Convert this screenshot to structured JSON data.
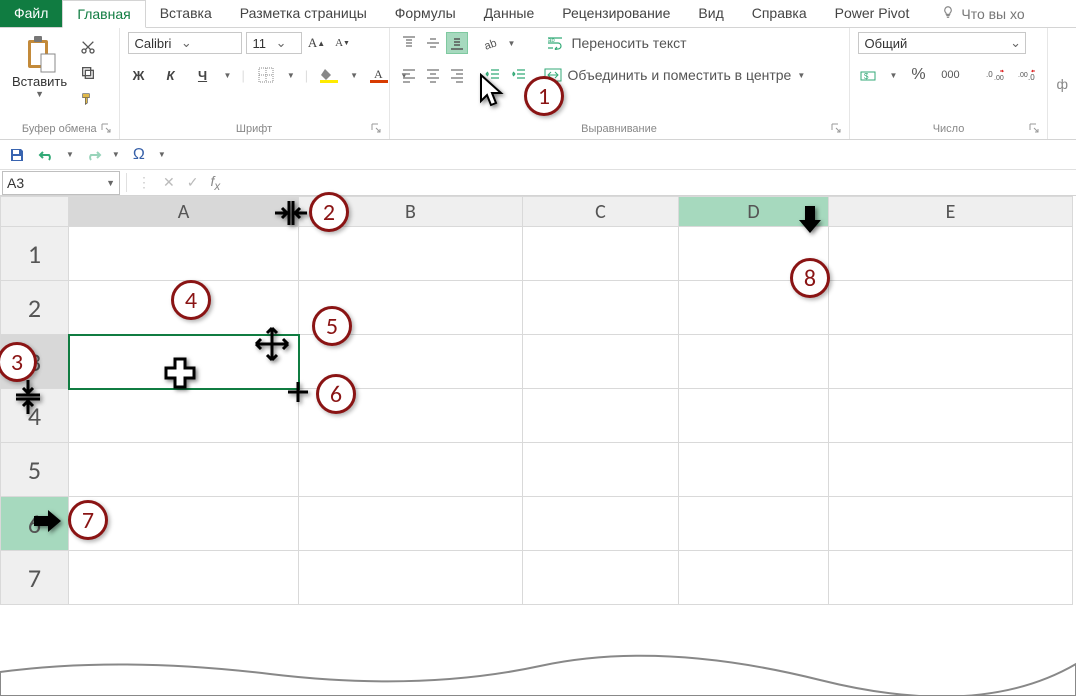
{
  "tabs": {
    "file": "Файл",
    "home": "Главная",
    "insert": "Вставка",
    "layout": "Разметка страницы",
    "formulas": "Формулы",
    "data": "Данные",
    "review": "Рецензирование",
    "view": "Вид",
    "help": "Справка",
    "powerpivot": "Power Pivot",
    "tellme": "Что вы хо"
  },
  "ribbon": {
    "paste": "Вставить",
    "clipboard_label": "Буфер обмена",
    "font_label": "Шрифт",
    "alignment_label": "Выравнивание",
    "number_label": "Число",
    "font_name": "Calibri",
    "font_size": "11",
    "bold": "Ж",
    "italic": "К",
    "underline": "Ч",
    "wrap_text": "Переносить текст",
    "merge_center": "Объединить и поместить в центре",
    "number_format": "Общий",
    "percent_sign": "%",
    "thousands": "000"
  },
  "namebox": "A3",
  "grid": {
    "columns": [
      "A",
      "B",
      "C",
      "D",
      "E"
    ],
    "rows": [
      "1",
      "2",
      "3",
      "4",
      "5",
      "6",
      "7"
    ],
    "active_cell": "A3",
    "selected_col": "D",
    "selected_row": "6"
  },
  "annotations": [
    "1",
    "2",
    "3",
    "4",
    "5",
    "6",
    "7",
    "8"
  ]
}
